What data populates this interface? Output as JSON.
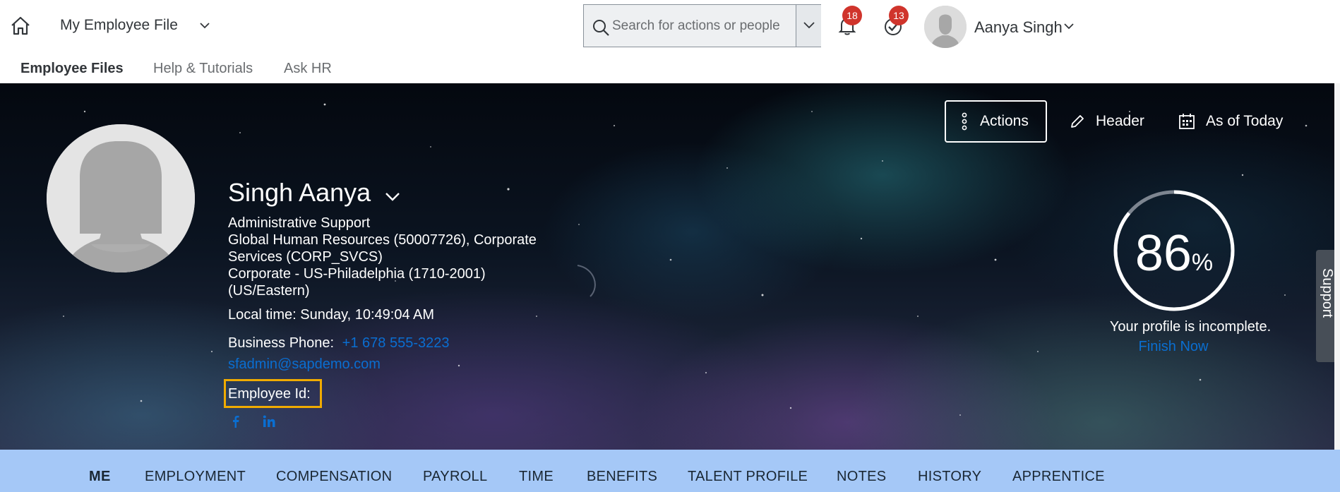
{
  "shell": {
    "app_title": "My Employee File",
    "search_placeholder": "Search for actions or people",
    "notifications_count": "18",
    "todo_count": "13",
    "user_name": "Aanya Singh"
  },
  "subnav": {
    "items": [
      {
        "label": "Employee Files",
        "active": true
      },
      {
        "label": "Help & Tutorials",
        "active": false
      },
      {
        "label": "Ask HR",
        "active": false
      }
    ]
  },
  "hero": {
    "buttons": {
      "actions": "Actions",
      "header": "Header",
      "as_of": "As of Today"
    },
    "employee": {
      "name": "Singh Aanya",
      "job_title": "Administrative Support",
      "department_line1": "Global Human Resources (50007726), Corporate",
      "department_line2": "Services (CORP_SVCS)",
      "location_line1": "Corporate - US-Philadelphia (1710-2001)",
      "location_line2": "(US/Eastern)",
      "local_time": "Local time: Sunday, 10:49:04 AM",
      "business_phone_label": "Business Phone:",
      "business_phone": "+1 678 555-3223",
      "email": "sfadmin@sapdemo.com",
      "employee_id_label": "Employee Id:"
    },
    "profile": {
      "completion_percent": 86,
      "percent_number": "86",
      "percent_symbol": "%",
      "status_text": "Your profile is incomplete.",
      "finish_link": "Finish Now"
    },
    "support_label": "Support"
  },
  "tabs": [
    {
      "label": "ME",
      "active": true
    },
    {
      "label": "EMPLOYMENT",
      "active": false
    },
    {
      "label": "COMPENSATION",
      "active": false
    },
    {
      "label": "PAYROLL",
      "active": false
    },
    {
      "label": "TIME",
      "active": false
    },
    {
      "label": "BENEFITS",
      "active": false
    },
    {
      "label": "TALENT PROFILE",
      "active": false
    },
    {
      "label": "NOTES",
      "active": false
    },
    {
      "label": "HISTORY",
      "active": false
    },
    {
      "label": "APPRENTICE",
      "active": false
    }
  ],
  "colors": {
    "accent_link": "#0a6ed1",
    "badge": "#d0342c",
    "highlight": "#f0ab00",
    "tab_strip": "#a5c8f7"
  },
  "icons": {
    "home": "home-icon",
    "app_menu": "chevron-down-icon",
    "search": "search-icon",
    "notifications": "bell-icon",
    "todo": "checkmark-circle-icon",
    "more": "vertical-ellipsis-icon",
    "edit": "pencil-icon",
    "calendar": "calendar-icon",
    "facebook": "facebook-icon",
    "linkedin": "linkedin-icon"
  }
}
